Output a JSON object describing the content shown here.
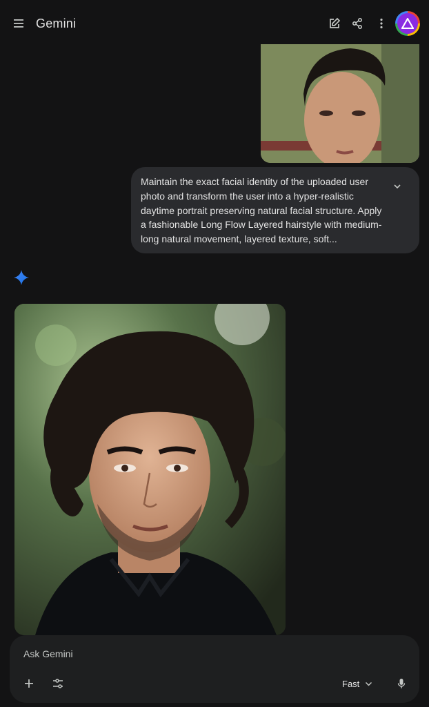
{
  "header": {
    "title": "Gemini",
    "icons": {
      "menu": "menu-icon",
      "edit": "edit-icon",
      "share": "share-icon",
      "more": "more-vert-icon",
      "avatar": "avatar-icon"
    }
  },
  "conversation": {
    "user_message": {
      "image": "uploaded-user-photo",
      "prompt": "Maintain the exact facial identity of the uploaded user photo and transform the user into a hyper-realistic daytime portrait preserving natural facial structure. Apply a fashionable Long Flow Layered hairstyle with medium-long natural movement, layered texture, soft..."
    },
    "response": {
      "icon": "gemini-spark-icon",
      "image": "generated-portrait"
    }
  },
  "composer": {
    "placeholder": "Ask Gemini",
    "model_label": "Fast",
    "icons": {
      "add": "plus-icon",
      "tools": "tune-icon",
      "dropdown": "chevron-down-icon",
      "mic": "mic-icon"
    }
  },
  "colors": {
    "background": "#131314",
    "bubble": "#2a2b2e",
    "panel": "#1e1f20",
    "accent_blue": "#4285f4"
  }
}
